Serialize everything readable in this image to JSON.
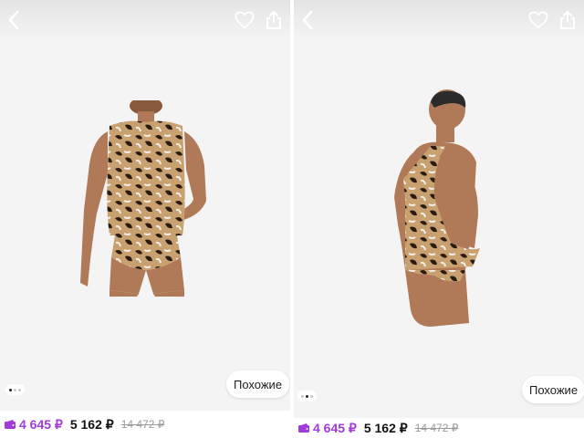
{
  "panels": [
    {
      "similar_label": "Похожие",
      "prices": {
        "wallet_price": "4 645 ₽",
        "price": "5 162 ₽",
        "old_price": "14 472 ₽"
      },
      "photo_alt": "Mannequin front view",
      "dots": {
        "count": 3,
        "active": 1
      }
    },
    {
      "similar_label": "Похожие",
      "prices": {
        "wallet_price": "4 645 ₽",
        "price": "5 162 ₽",
        "old_price": "14 472 ₽"
      },
      "photo_alt": "Mannequin back view",
      "dots": {
        "count": 3,
        "active": 2
      }
    }
  ],
  "icons": {
    "back": "chevron-left-icon",
    "favorite": "heart-icon",
    "share": "share-icon",
    "wallet": "wallet-icon"
  },
  "colors": {
    "wallet_price": "#a23bd9",
    "background": "#f4f4f4",
    "leopard_base": "#c9a070",
    "leopard_spot": "#2a1c12",
    "skin": "#b07a58"
  }
}
